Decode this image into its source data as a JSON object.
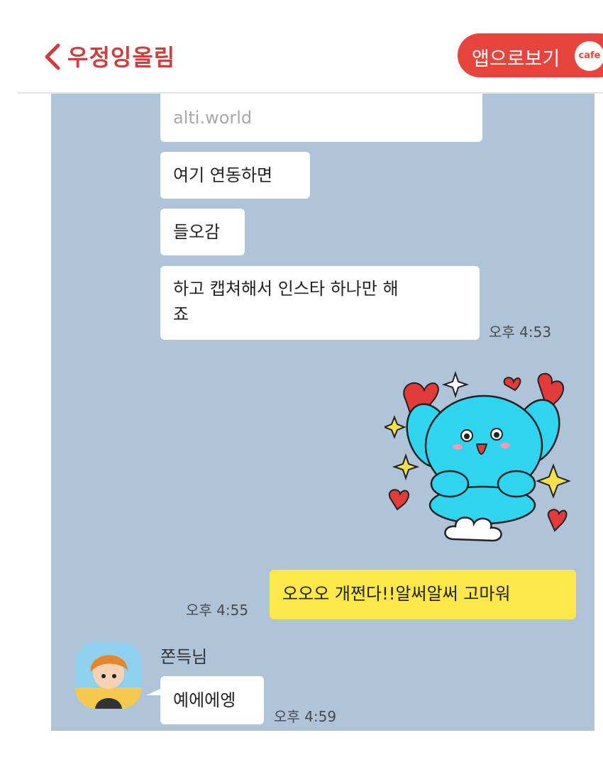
{
  "header": {
    "title": "우정잉올림",
    "app_button_label": "앱으로보기",
    "cafe_badge": "cafe"
  },
  "messages": [
    {
      "text": "alti.world"
    },
    {
      "text": "여기 연동하면"
    },
    {
      "text": "들오감"
    },
    {
      "text_line1": "하고 캡쳐해서 인스타 하나만 해",
      "text_line2": "죠",
      "time": "오후 4:53"
    },
    {
      "text": "오오오 개쩐다!!알써알써 고마워",
      "time": "오후 4:55"
    },
    {
      "sender": "쫀득님",
      "text": "예에에엥",
      "time": "오후 4:59"
    }
  ],
  "colors": {
    "accent": "#e8443e",
    "chat_background": "#afc3d9",
    "my_bubble": "#fde84a",
    "other_bubble": "#ffffff"
  },
  "icons": [
    "back-chevron-icon",
    "cafe-badge-icon",
    "emoticon-sticker",
    "profile-avatar"
  ]
}
